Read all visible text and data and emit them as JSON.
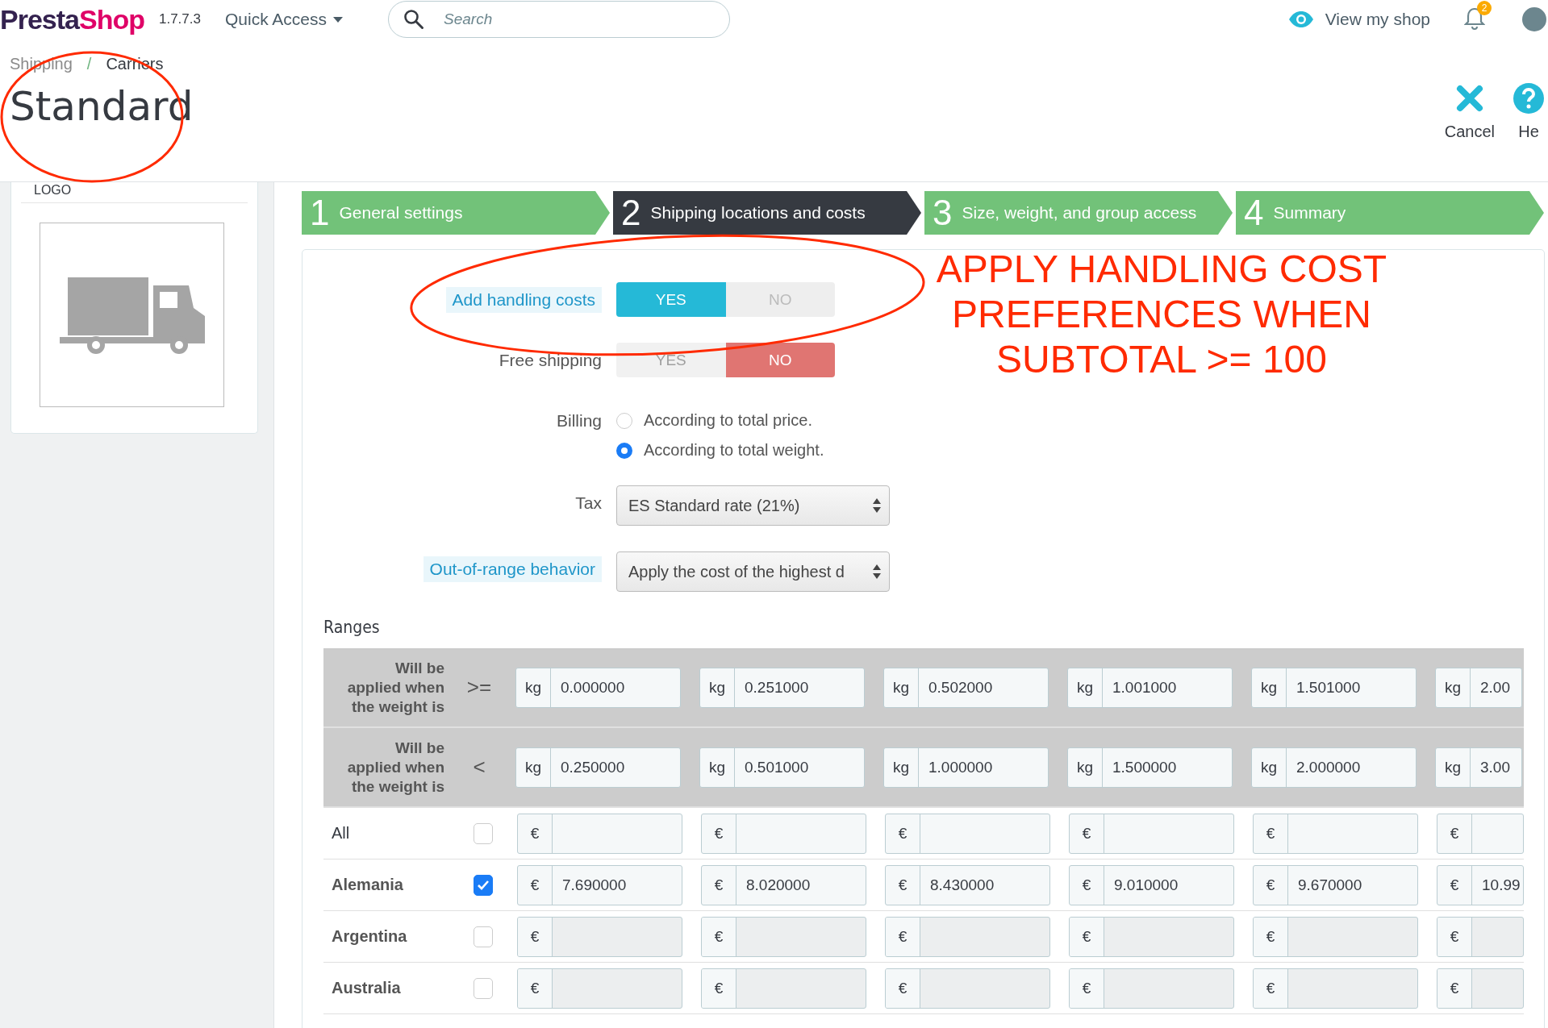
{
  "topbar": {
    "logo": [
      "Presta",
      "Shop"
    ],
    "version": "1.7.7.3",
    "quick_access": "Quick Access",
    "search": {
      "placeholder": "Search"
    },
    "view_shop": "View my shop",
    "notification_count": "2"
  },
  "breadcrumb": {
    "items": [
      "Shipping",
      "Carriers"
    ],
    "separator": "/"
  },
  "page_title": "Standard",
  "toolbar": [
    {
      "kind": "cancel",
      "label": "Cancel"
    },
    {
      "kind": "help",
      "label": "He"
    }
  ],
  "sidebar": {
    "heading": "LOGO"
  },
  "steps": [
    {
      "number": "1",
      "label": "General settings",
      "selected": false
    },
    {
      "number": "2",
      "label": "Shipping locations and costs",
      "selected": true
    },
    {
      "number": "3",
      "label": "Size, weight, and group access",
      "selected": false
    },
    {
      "number": "4",
      "label": "Summary",
      "selected": false
    }
  ],
  "form": [
    {
      "kind": "toggle",
      "label": "Add handling costs",
      "hint": true,
      "disabled": false,
      "options": [
        {
          "label": "YES",
          "selected": true
        },
        {
          "label": "NO",
          "selected": false
        }
      ]
    },
    {
      "kind": "toggle",
      "label": "Free shipping",
      "hint": false,
      "disabled": true,
      "options": [
        {
          "label": "YES",
          "selected": false
        },
        {
          "label": "NO",
          "selected": true
        }
      ]
    },
    {
      "kind": "radio",
      "label": "Billing",
      "hint": false,
      "options": [
        {
          "label": "According to total price.",
          "selected": false
        },
        {
          "label": "According to total weight.",
          "selected": true
        }
      ]
    },
    {
      "kind": "select",
      "label": "Tax",
      "hint": false,
      "value": "ES Standard rate (21%)"
    },
    {
      "kind": "select",
      "label": "Out-of-range behavior",
      "hint": true,
      "value": "Apply the cost of the highest d"
    }
  ],
  "ranges": {
    "heading": "Ranges",
    "limits": [
      {
        "label": "Will be applied when the weight is",
        "operator": ">=",
        "cells": [
          {
            "unit": "kg",
            "value": "0.000000"
          },
          {
            "unit": "kg",
            "value": "0.251000"
          },
          {
            "unit": "kg",
            "value": "0.502000"
          },
          {
            "unit": "kg",
            "value": "1.001000"
          },
          {
            "unit": "kg",
            "value": "1.501000"
          },
          {
            "unit": "kg",
            "value": "2.00"
          }
        ]
      },
      {
        "label": "Will be applied when the weight is",
        "operator": "<",
        "cells": [
          {
            "unit": "kg",
            "value": "0.250000"
          },
          {
            "unit": "kg",
            "value": "0.501000"
          },
          {
            "unit": "kg",
            "value": "1.000000"
          },
          {
            "unit": "kg",
            "value": "1.500000"
          },
          {
            "unit": "kg",
            "value": "2.000000"
          },
          {
            "unit": "kg",
            "value": "3.00"
          }
        ]
      }
    ],
    "zones": [
      {
        "kind": "all",
        "name": "All",
        "checked": false,
        "cells": [
          {
            "currency": "€"
          },
          {
            "currency": "€"
          },
          {
            "currency": "€"
          },
          {
            "currency": "€"
          },
          {
            "currency": "€"
          },
          {
            "currency": "€"
          }
        ]
      },
      {
        "kind": "zone",
        "name": "Alemania",
        "checked": true,
        "cells": [
          {
            "currency": "€",
            "value": "7.690000"
          },
          {
            "currency": "€",
            "value": "8.020000"
          },
          {
            "currency": "€",
            "value": "8.430000"
          },
          {
            "currency": "€",
            "value": "9.010000"
          },
          {
            "currency": "€",
            "value": "9.670000"
          },
          {
            "currency": "€",
            "value": "10.99"
          }
        ]
      },
      {
        "kind": "zone",
        "name": "Argentina",
        "checked": false,
        "cells": [
          {
            "currency": "€"
          },
          {
            "currency": "€"
          },
          {
            "currency": "€"
          },
          {
            "currency": "€"
          },
          {
            "currency": "€"
          },
          {
            "currency": "€"
          }
        ]
      },
      {
        "kind": "zone",
        "name": "Australia",
        "checked": false,
        "cells": [
          {
            "currency": "€"
          },
          {
            "currency": "€"
          },
          {
            "currency": "€"
          },
          {
            "currency": "€"
          },
          {
            "currency": "€"
          },
          {
            "currency": "€"
          }
        ]
      }
    ]
  },
  "annotation": {
    "note": "APPLY HANDLING COST PREFERENCES WHEN SUBTOTAL >= 100"
  }
}
